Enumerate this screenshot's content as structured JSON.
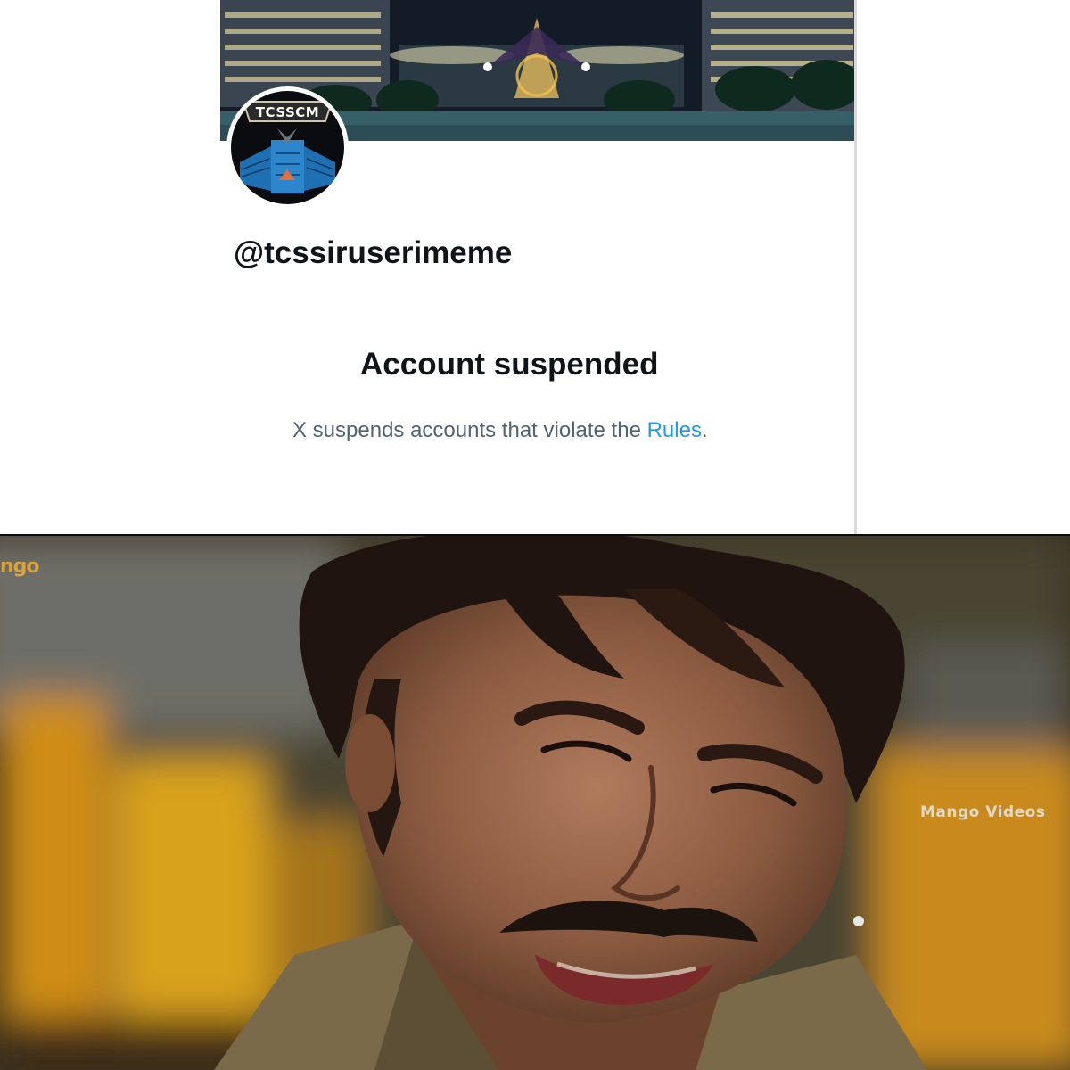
{
  "profile": {
    "avatar_text": "TCSSCM",
    "handle": "@tcssiruserimeme",
    "suspension": {
      "title": "Account suspended",
      "message_prefix": "X suspends accounts that violate the ",
      "link_text": "Rules",
      "message_suffix": "."
    },
    "colors": {
      "text_primary": "#0f1419",
      "text_secondary": "#536471",
      "link": "#1d9bf0"
    }
  },
  "still": {
    "watermark_top": "ngo",
    "watermark_right": "Mango Videos"
  }
}
